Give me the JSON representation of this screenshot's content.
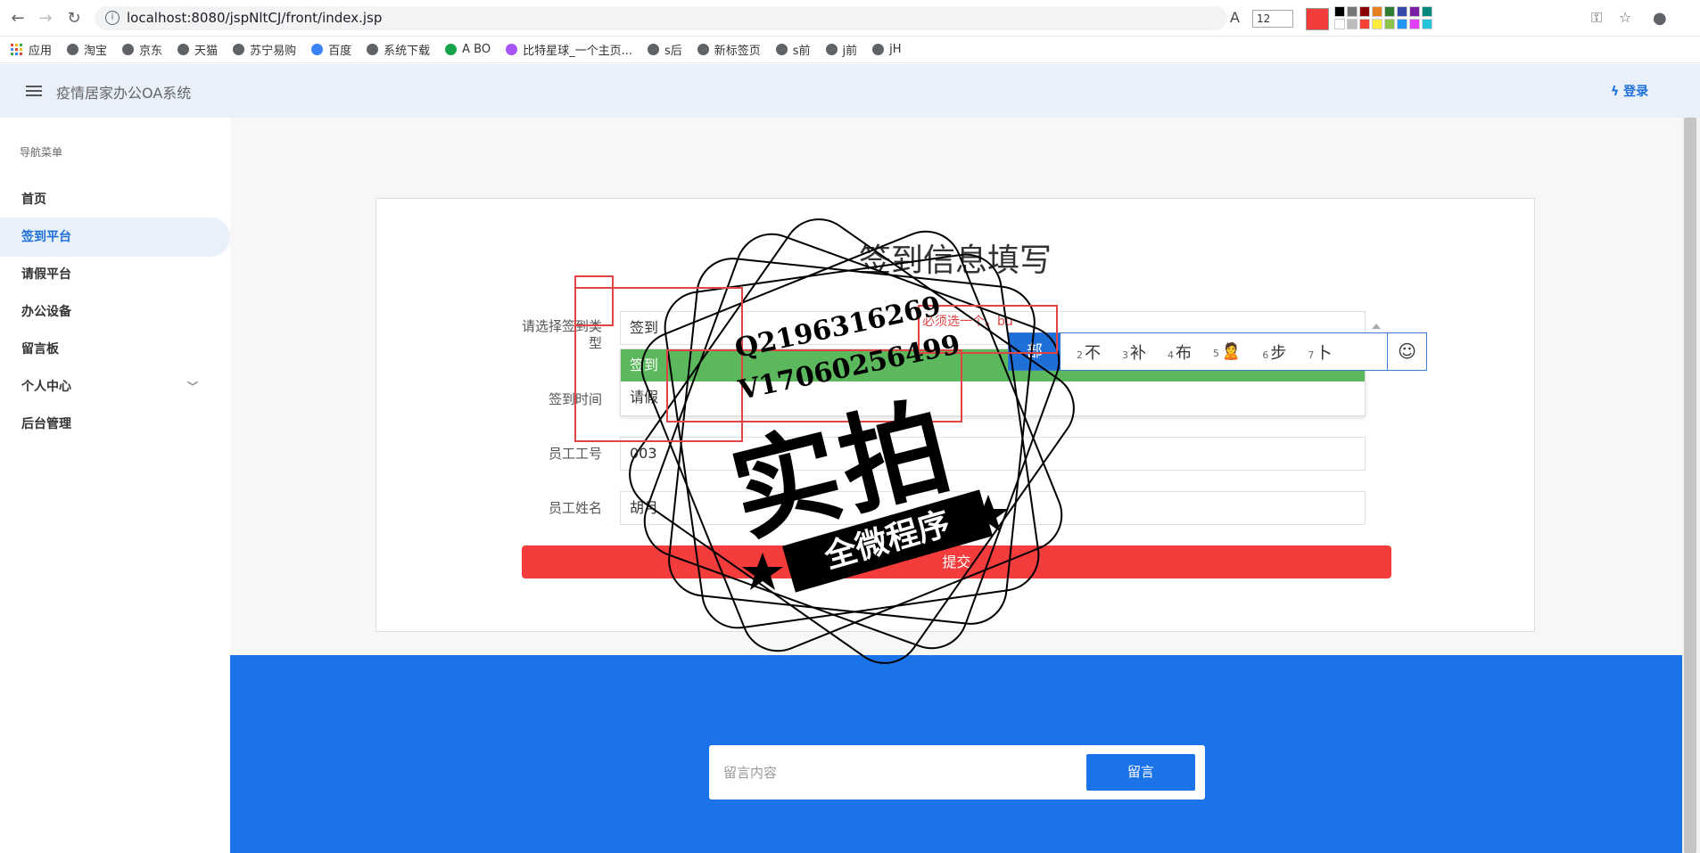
{
  "browser": {
    "url": "localhost:8080/jspNltCJ/front/index.jsp",
    "font_size": "12",
    "bookmarks": [
      "应用",
      "淘宝",
      "京东",
      "天猫",
      "苏宁易购",
      "百度",
      "系统下载",
      "A BO",
      "比特星球_一个主页...",
      "s后",
      "新标签页",
      "s前",
      "j前",
      "jH"
    ]
  },
  "app": {
    "title": "疫情居家办公OA系统",
    "login": "登录"
  },
  "sidebar": {
    "heading": "导航菜单",
    "items": [
      "首页",
      "签到平台",
      "请假平台",
      "办公设备",
      "留言板",
      "个人中心",
      "后台管理"
    ],
    "active": "签到平台"
  },
  "form": {
    "title": "签到信息填写",
    "type_label": "请选择签到类型",
    "type_value": "签到",
    "type_options": [
      "签到",
      "请假"
    ],
    "time_label": "签到时间",
    "id_label": "员工工号",
    "id_value": "003",
    "name_label": "员工姓名",
    "name_value": "胡月",
    "submit": "提交",
    "error": "必须选一个。bu"
  },
  "ime": {
    "first": "部",
    "candidates": [
      {
        "n": "2",
        "c": "不"
      },
      {
        "n": "3",
        "c": "补"
      },
      {
        "n": "4",
        "c": "布"
      },
      {
        "n": "5",
        "c": "🙎"
      },
      {
        "n": "6",
        "c": "步"
      },
      {
        "n": "7",
        "c": "卜"
      }
    ],
    "emoji": "☺"
  },
  "footer": {
    "placeholder": "留言内容",
    "button": "留言"
  },
  "watermark": {
    "line1": "Q2196316269",
    "line2": "V17060256499",
    "big": "实拍",
    "banner": "全微程序"
  },
  "colors": {
    "accent": "#1a73e8",
    "submit": "#f43c3c",
    "selected_option": "#5cb85c",
    "header_bg": "#e8f0fa"
  }
}
